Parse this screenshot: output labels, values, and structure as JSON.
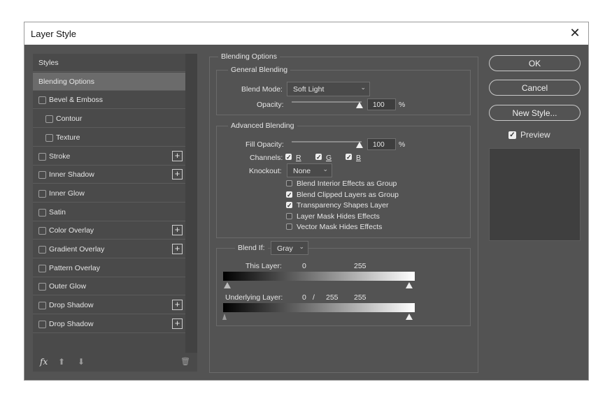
{
  "window": {
    "title": "Layer Style",
    "close_glyph": "✕"
  },
  "styles_panel": {
    "items": [
      {
        "label": "Styles",
        "selected": false,
        "checkbox": false,
        "plus": false,
        "indent": false
      },
      {
        "label": "Blending Options",
        "selected": true,
        "checkbox": false,
        "plus": false,
        "indent": false
      },
      {
        "label": "Bevel & Emboss",
        "selected": false,
        "checkbox": true,
        "plus": false,
        "indent": false
      },
      {
        "label": "Contour",
        "selected": false,
        "checkbox": true,
        "plus": false,
        "indent": true
      },
      {
        "label": "Texture",
        "selected": false,
        "checkbox": true,
        "plus": false,
        "indent": true
      },
      {
        "label": "Stroke",
        "selected": false,
        "checkbox": true,
        "plus": true,
        "indent": false
      },
      {
        "label": "Inner Shadow",
        "selected": false,
        "checkbox": true,
        "plus": true,
        "indent": false
      },
      {
        "label": "Inner Glow",
        "selected": false,
        "checkbox": true,
        "plus": false,
        "indent": false
      },
      {
        "label": "Satin",
        "selected": false,
        "checkbox": true,
        "plus": false,
        "indent": false
      },
      {
        "label": "Color Overlay",
        "selected": false,
        "checkbox": true,
        "plus": true,
        "indent": false
      },
      {
        "label": "Gradient Overlay",
        "selected": false,
        "checkbox": true,
        "plus": true,
        "indent": false
      },
      {
        "label": "Pattern Overlay",
        "selected": false,
        "checkbox": true,
        "plus": false,
        "indent": false
      },
      {
        "label": "Outer Glow",
        "selected": false,
        "checkbox": true,
        "plus": false,
        "indent": false
      },
      {
        "label": "Drop Shadow",
        "selected": false,
        "checkbox": true,
        "plus": true,
        "indent": false
      },
      {
        "label": "Drop Shadow",
        "selected": false,
        "checkbox": true,
        "plus": true,
        "indent": false
      }
    ],
    "plus_glyph": "+",
    "footer": {
      "fx": "fx",
      "up_glyph": "⬆",
      "down_glyph": "⬇",
      "trash_glyph": "🗑"
    }
  },
  "blending_options": {
    "title": "Blending Options",
    "general": {
      "title": "General Blending",
      "blend_mode_label": "Blend Mode:",
      "blend_mode_value": "Soft Light",
      "opacity_label": "Opacity:",
      "opacity_value": "100",
      "opacity_fraction": 1.0,
      "percent": "%"
    },
    "advanced": {
      "title": "Advanced Blending",
      "fill_opacity_label": "Fill Opacity:",
      "fill_opacity_value": "100",
      "fill_opacity_fraction": 1.0,
      "percent": "%",
      "channels_label": "Channels:",
      "channels": [
        {
          "label": "R",
          "checked": true
        },
        {
          "label": "G",
          "checked": true
        },
        {
          "label": "B",
          "checked": true
        }
      ],
      "knockout_label": "Knockout:",
      "knockout_value": "None",
      "options": [
        {
          "label": "Blend Interior Effects as Group",
          "checked": false
        },
        {
          "label": "Blend Clipped Layers as Group",
          "checked": true
        },
        {
          "label": "Transparency Shapes Layer",
          "checked": true
        },
        {
          "label": "Layer Mask Hides Effects",
          "checked": false
        },
        {
          "label": "Vector Mask Hides Effects",
          "checked": false
        }
      ]
    },
    "blend_if": {
      "label": "Blend If:",
      "value": "Gray",
      "this_layer_label": "This Layer:",
      "this_layer_min": "0",
      "this_layer_max": "255",
      "underlying_label": "Underlying Layer:",
      "underlying_min": "0",
      "underlying_sep": "/",
      "underlying_mid": "255",
      "underlying_max": "255"
    }
  },
  "buttons": {
    "ok": "OK",
    "cancel": "Cancel",
    "new_style": "New Style...",
    "preview_label": "Preview",
    "preview_checked": true
  },
  "colors": {
    "dialog_bg": "#535353",
    "panel_bg": "#4a4a4a",
    "selected_row": "#6b6b6b"
  }
}
